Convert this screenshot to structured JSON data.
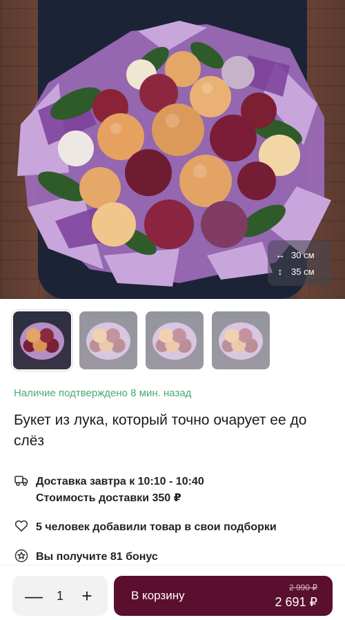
{
  "product": {
    "dimensions": {
      "width": "30 см",
      "height": "35 см"
    },
    "availability": "Наличие подтверждено 8 мин. назад",
    "title": "Букет из лука, который точно очарует ее до слёз"
  },
  "info": {
    "delivery_line1": "Доставка завтра к 10:10 - 10:40",
    "delivery_line2": "Стоимость доставки 350 ₽",
    "likes": "5 человек добавили товар в свои подборки",
    "bonus": "Вы получите 81 бонус"
  },
  "cart": {
    "quantity": "1",
    "minus": "—",
    "plus": "+",
    "button_label": "В корзину",
    "old_price": "2 990 ₽",
    "price": "2 691 ₽"
  },
  "icons": {
    "width_icon": "↔",
    "height_icon": "↕",
    "delivery_icon": "truck",
    "likes_icon": "heart",
    "bonus_icon": "star-circle"
  },
  "colors": {
    "accent": "#5a0f2e",
    "availability": "#4aa874"
  }
}
